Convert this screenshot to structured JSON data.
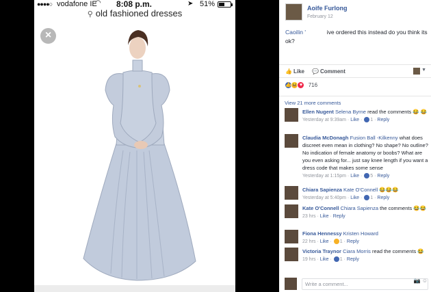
{
  "phone": {
    "status_bar": {
      "signal": "●●●●○",
      "carrier": "vodafone IE",
      "wifi_icon": "wifi-icon",
      "time": "8:08 p.m.",
      "location_icon": "location-arrow-icon",
      "battery_percent": "51%",
      "battery_level": 0.51
    },
    "search": {
      "icon": "search-icon",
      "query": "old fashioned dresses"
    },
    "close_icon": "close-icon"
  },
  "post": {
    "author": "Aoife Furlong",
    "date": "February 12",
    "mention": "Caoilin '",
    "text": "ive ordered this instead do you think its ok?",
    "actions": {
      "like": "Like",
      "comment": "Comment"
    },
    "reactions_count": "716",
    "view_more": "View 21 more comments"
  },
  "comments": [
    {
      "name": "Ellen Nugent",
      "mention": "Selena Byrne",
      "text": "read the comments",
      "emoji": "😂 😂",
      "time": "Yesterday at 9:39am",
      "like": "Like",
      "react_count": "1",
      "reply": "Reply"
    },
    {
      "name": "Claudia McDonagh",
      "mention": "Fusion Ball -Kilkenny",
      "text": "what does discreet even mean in clothing? No shape? No outline? No indication of female anatomy or boobs? What are you even asking for... just say knee length if you want a dress code that makes some sense",
      "emoji": "",
      "time": "Yesterday at 1:15pm",
      "like": "Like",
      "react_count": "5",
      "reply": "Reply"
    },
    {
      "name": "Chiara Sapienza",
      "mention": "Kate O'Connell",
      "text": "",
      "emoji": "😂😂😂",
      "time": "Yesterday at 5:40pm",
      "like": "Like",
      "react_count": "1",
      "reply": "Reply"
    },
    {
      "name": "Kate O'Connell",
      "mention": "Chiara Sapienza",
      "text": "the comments",
      "emoji": "😂😂",
      "time": "23 hrs",
      "like": "Like",
      "react_count": "",
      "reply": "Reply"
    },
    {
      "name": "Fiona Hennessy",
      "mention": "Kristen Howard",
      "text": "",
      "emoji": "",
      "time": "22 hrs",
      "like": "Like",
      "react_count": "1",
      "reply": "Reply"
    },
    {
      "name": "Victoria Traynor",
      "mention": "Ciara Morris",
      "text": "read the comments",
      "emoji": "😂",
      "time": "19 hrs",
      "like": "Like",
      "react_count": "1",
      "reply": "Reply"
    }
  ],
  "composer": {
    "placeholder": "Write a comment...",
    "camera_icon": "camera-icon",
    "sticker_icon": "sticker-icon"
  },
  "colors": {
    "fb_link": "#365899",
    "dress_blue": "#b9c4d6"
  }
}
